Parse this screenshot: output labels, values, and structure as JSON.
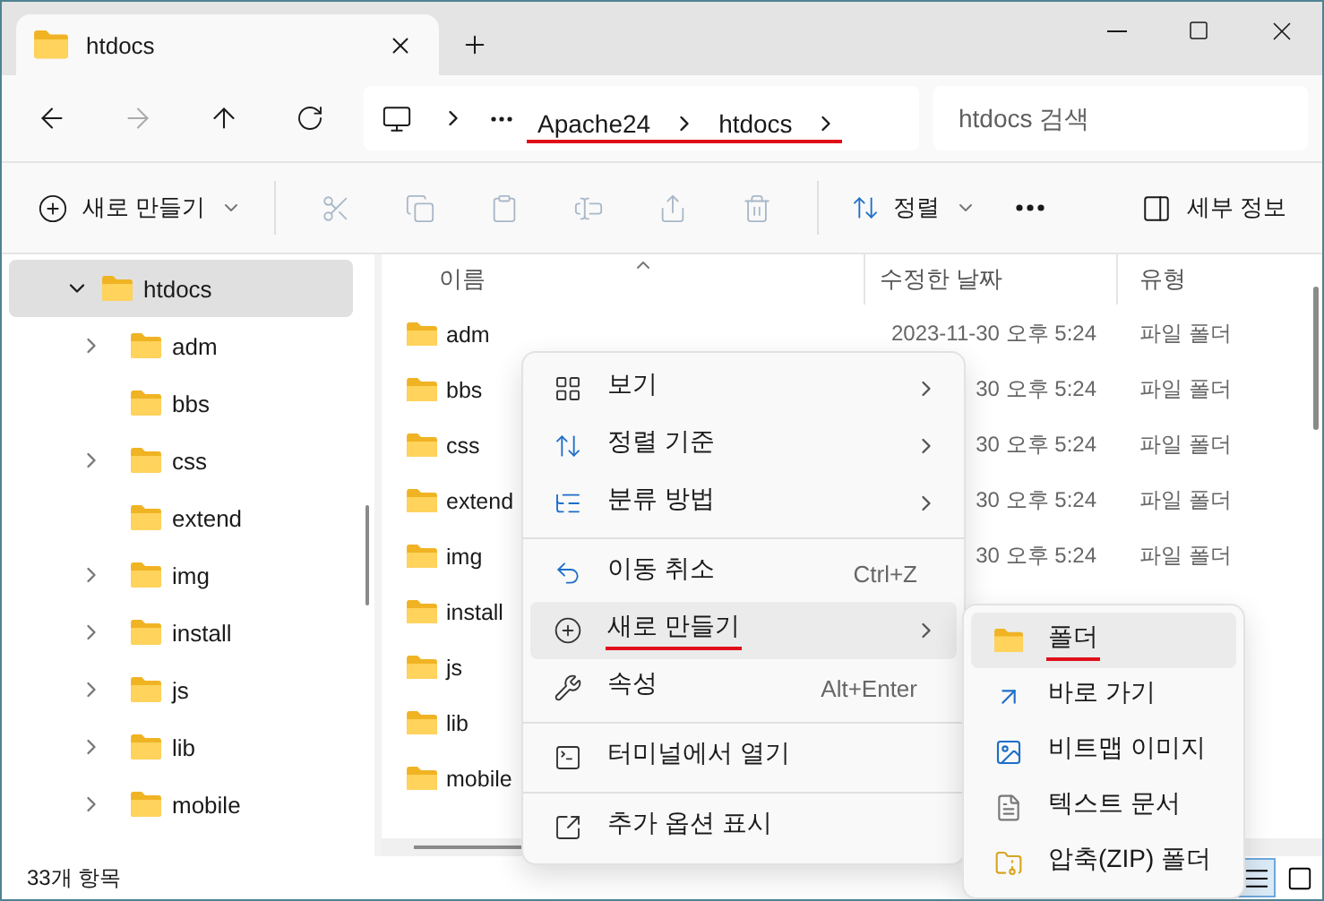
{
  "window": {
    "tab_title": "htdocs"
  },
  "nav": {
    "address": {
      "segments": [
        "Apache24",
        "htdocs"
      ],
      "annotated": true
    },
    "search": {
      "placeholder": "htdocs 검색"
    }
  },
  "toolbar": {
    "new_label": "새로 만들기",
    "tools": [
      {
        "kind": "cut",
        "disabled": true
      },
      {
        "kind": "copy",
        "disabled": true
      },
      {
        "kind": "paste",
        "disabled": true
      },
      {
        "kind": "rename",
        "disabled": true
      },
      {
        "kind": "share",
        "disabled": true
      },
      {
        "kind": "delete",
        "disabled": true
      }
    ],
    "sort_label": "정렬",
    "details_label": "세부 정보"
  },
  "sidebar": {
    "items": [
      {
        "label": "htdocs",
        "selected": true,
        "expanded": true,
        "children": [
          {
            "label": "adm",
            "selected": false,
            "has_children": true
          },
          {
            "label": "bbs",
            "selected": false,
            "has_children": false
          },
          {
            "label": "css",
            "selected": false,
            "has_children": true
          },
          {
            "label": "extend",
            "selected": false,
            "has_children": false
          },
          {
            "label": "img",
            "selected": false,
            "has_children": true
          },
          {
            "label": "install",
            "selected": false,
            "has_children": true
          },
          {
            "label": "js",
            "selected": false,
            "has_children": true
          },
          {
            "label": "lib",
            "selected": false,
            "has_children": true
          },
          {
            "label": "mobile",
            "selected": false,
            "has_children": true
          }
        ]
      }
    ]
  },
  "file_list": {
    "columns": [
      "이름",
      "수정한 날짜",
      "유형"
    ],
    "rows": [
      {
        "name": "adm",
        "date": "2023-11-30 오후 5:24",
        "type": "파일 폴더"
      },
      {
        "name": "bbs",
        "date": "30 오후 5:24",
        "type": "파일 폴더"
      },
      {
        "name": "css",
        "date": "30 오후 5:24",
        "type": "파일 폴더"
      },
      {
        "name": "extend",
        "date": "30 오후 5:24",
        "type": "파일 폴더"
      },
      {
        "name": "img",
        "date": "30 오후 5:24",
        "type": "파일 폴더"
      },
      {
        "name": "install"
      },
      {
        "name": "js"
      },
      {
        "name": "lib"
      },
      {
        "name": "mobile"
      }
    ]
  },
  "context_menu": {
    "groups": [
      [
        {
          "kind": "view",
          "label": "보기",
          "submenu": true,
          "highlighted": false,
          "annotated": false
        },
        {
          "kind": "sort",
          "label": "정렬 기준",
          "submenu": true,
          "highlighted": false,
          "annotated": false
        },
        {
          "kind": "group",
          "label": "분류 방법",
          "submenu": true,
          "highlighted": false,
          "annotated": false
        }
      ],
      [
        {
          "kind": "undo",
          "label": "이동 취소",
          "shortcut": "Ctrl+Z",
          "submenu": false,
          "highlighted": false,
          "annotated": false
        },
        {
          "kind": "new",
          "label": "새로 만들기",
          "submenu": true,
          "highlighted": true,
          "annotated": true
        },
        {
          "kind": "properties",
          "label": "속성",
          "shortcut": "Alt+Enter",
          "submenu": false,
          "highlighted": false,
          "annotated": false
        }
      ],
      [
        {
          "kind": "terminal",
          "label": "터미널에서 열기",
          "submenu": false,
          "highlighted": false,
          "annotated": false
        }
      ],
      [
        {
          "kind": "more",
          "label": "추가 옵션 표시",
          "submenu": false,
          "highlighted": false,
          "annotated": false
        }
      ]
    ]
  },
  "submenu": {
    "items": [
      {
        "kind": "folder",
        "label": "폴더",
        "highlighted": true,
        "annotated": true
      },
      {
        "kind": "shortcut",
        "label": "바로 가기",
        "highlighted": false,
        "annotated": false
      },
      {
        "kind": "bitmap",
        "label": "비트맵 이미지",
        "highlighted": false,
        "annotated": false
      },
      {
        "kind": "text",
        "label": "텍스트 문서",
        "highlighted": false,
        "annotated": false
      },
      {
        "kind": "zip",
        "label": "압축(ZIP) 폴더",
        "highlighted": false,
        "annotated": false
      }
    ]
  },
  "status_bar": {
    "count": "33개 항목",
    "views": [
      {
        "kind": "details",
        "selected": true
      },
      {
        "kind": "tiles",
        "selected": false
      }
    ]
  }
}
